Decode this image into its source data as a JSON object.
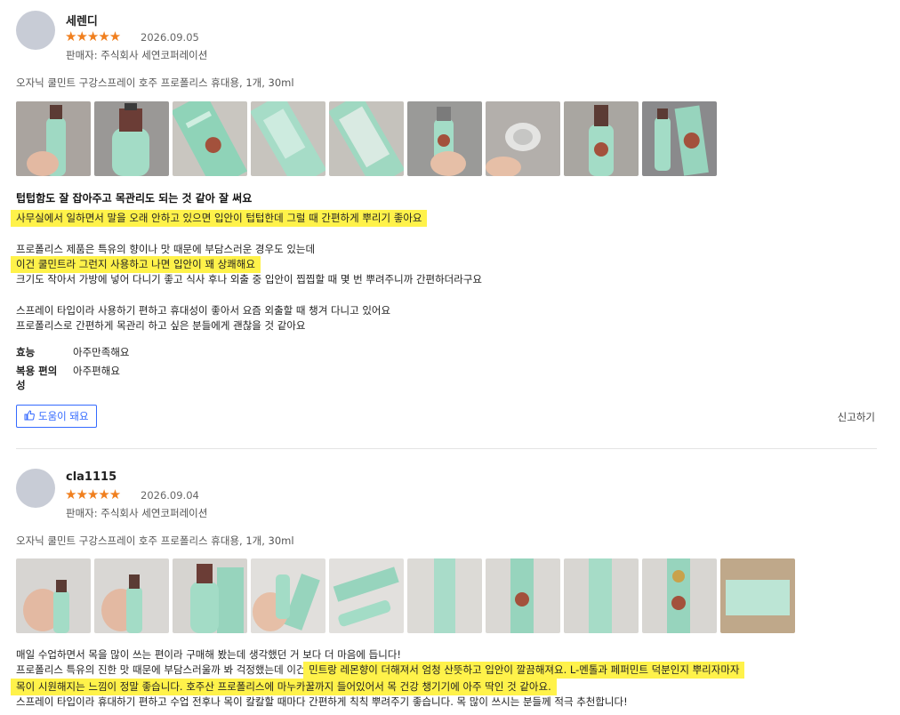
{
  "review1": {
    "author": "세렌디",
    "stars": "★★★★★",
    "rating": 5,
    "date": "2026.09.05",
    "seller": "판매자: 주식회사 세연코퍼레이션",
    "product": "오자닉 쿨민트 구강스프레이 호주 프로폴리스 휴대용, 1개, 30ml",
    "headline": "텁텁함도 잘 잡아주고 목관리도 되는 것 같아 잘 써요",
    "lines": [
      "사무실에서 일하면서 말을 오래 안하고 있으면 입안이 텁텁한데 그럴 때 간편하게 뿌리기 좋아요",
      "프로폴리스 제품은 특유의 향이나 맛 때문에 부담스러운 경우도 있는데",
      "이건 쿨민트라 그런지 사용하고 나면 입안이 꽤 상쾌해요",
      "크기도 작아서 가방에 넣어 다니기 좋고 식사 후나 외출 중 입안이 찝찝할 때 몇 번 뿌려주니까 간편하더라구요",
      "스프레이 타입이라 사용하기 편하고 휴대성이 좋아서 요즘 외출할 때 챙겨 다니고 있어요",
      "프로폴리스로 간편하게 목관리 하고 싶은 분들에게 괜찮을 것 같아요"
    ],
    "survey": [
      {
        "label": "효능",
        "value": "아주만족해요"
      },
      {
        "label": "복용 편의성",
        "value": "아주편해요"
      }
    ],
    "helpful_label": "도움이 돼요",
    "report_label": "신고하기"
  },
  "review2": {
    "author": "cla1115",
    "stars": "★★★★★",
    "rating": 5,
    "date": "2026.09.04",
    "seller": "판매자: 주식회사 세연코퍼레이션",
    "product": "오자닉 쿨민트 구강스프레이 호주 프로폴리스 휴대용, 1개, 30ml",
    "line1": "매일 수업하면서 목을 많이 쓰는 편이라 구매해 봤는데 생각했던 거 보다 더 마음에 듭니다!",
    "line2a": "프로폴리스 특유의 진한 맛 때문에 부담스러울까 봐 걱정했는데 이건 ",
    "line2b": "민트랑 레몬향이 더해져서 엄청 산뜻하고 입안이 깔끔해져요. L-멘톨과 페퍼민트 덕분인지 뿌리자마자",
    "line3": "목이 시원해지는 느낌이 정말 좋습니다. 호주산 프로폴리스에 마누카꿀까지 들어있어서 목 건강 챙기기에 아주 딱인 것 같아요.",
    "line4": "스프레이 타입이라 휴대하기 편하고 수업 전후나 목이 칼칼할 때마다 간편하게 칙칙 뿌려주기 좋습니다. 목 많이 쓰시는 분들께 적극 추천합니다!"
  },
  "colors": {
    "accent": "#346aff",
    "star": "#f07f1e",
    "highlight": "#fff24a"
  },
  "icons": {
    "helpful": "thumbs-up-icon"
  }
}
